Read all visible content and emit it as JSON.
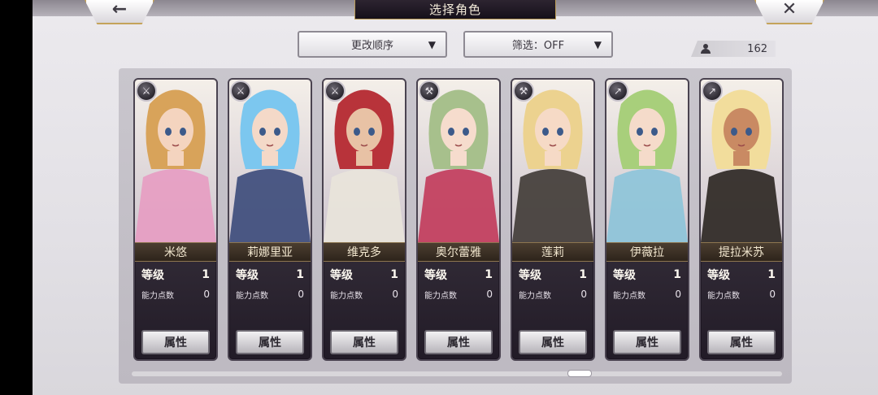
{
  "header": {
    "title": "选择角色",
    "back_icon": "←",
    "close_icon": "✕"
  },
  "controls": {
    "sort_label": "更改顺序",
    "filter_label": "筛选：OFF",
    "dropdown_arrow": "▼",
    "character_count": "162"
  },
  "labels": {
    "level": "等级",
    "ability_points": "能力点数",
    "attributes_button": "属性"
  },
  "characters": [
    {
      "name": "米悠",
      "level": "1",
      "ability_points": "0",
      "class_icon": "sword-icon",
      "hair": "#d8a35a",
      "accent": "#e79cc2",
      "skin": "#f4d4bf"
    },
    {
      "name": "莉娜里亚",
      "level": "1",
      "ability_points": "0",
      "class_icon": "sword-icon",
      "hair": "#7cc7ef",
      "accent": "#3b4a7a",
      "skin": "#f4d9c8"
    },
    {
      "name": "维克多",
      "level": "1",
      "ability_points": "0",
      "class_icon": "sword-icon",
      "hair": "#b8333a",
      "accent": "#e9e4da",
      "skin": "#e8c2a5"
    },
    {
      "name": "奥尔蕾雅",
      "level": "1",
      "ability_points": "0",
      "class_icon": "axe-icon",
      "hair": "#a7c08c",
      "accent": "#c23a5a",
      "skin": "#f6dccd"
    },
    {
      "name": "莲莉",
      "level": "1",
      "ability_points": "0",
      "class_icon": "axe-icon",
      "hair": "#ecd28f",
      "accent": "#3f3a35",
      "skin": "#f6dac6"
    },
    {
      "name": "伊薇拉",
      "level": "1",
      "ability_points": "0",
      "class_icon": "spear-icon",
      "hair": "#a8cf7b",
      "accent": "#8cc4d9",
      "skin": "#f5dbca"
    },
    {
      "name": "提拉米苏",
      "level": "1",
      "ability_points": "0",
      "class_icon": "spear-icon",
      "hair": "#f2dd9c",
      "accent": "#2a2520",
      "skin": "#c98a63"
    }
  ]
}
